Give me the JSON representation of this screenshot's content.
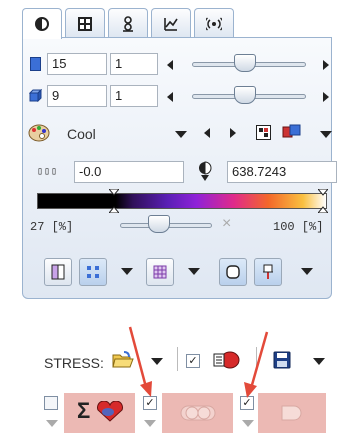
{
  "tabs": [
    {
      "icon": "contrast-icon"
    },
    {
      "icon": "grid-icon"
    },
    {
      "icon": "fusion-icon"
    },
    {
      "icon": "curve-icon"
    },
    {
      "icon": "signal-icon"
    }
  ],
  "image1": {
    "value_a": "15",
    "value_b": "1"
  },
  "image2": {
    "value_a": "9",
    "value_b": "1"
  },
  "colormap": {
    "label": "Cool"
  },
  "range": {
    "min": "-0.0",
    "max": "638.7243"
  },
  "threshold": {
    "low_label": "27 [%]",
    "high_label": "100 [%]",
    "close": "×"
  },
  "stress": {
    "label": "STRESS:"
  },
  "colors": {
    "accent_pink": "#ecb9b4",
    "arrow_red": "#e34a3a"
  }
}
